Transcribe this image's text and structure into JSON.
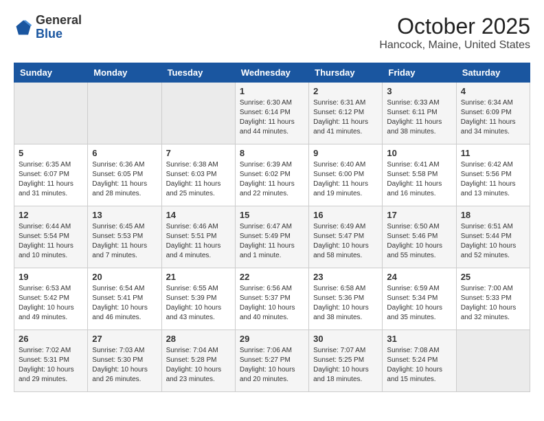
{
  "logo": {
    "general": "General",
    "blue": "Blue"
  },
  "header": {
    "title": "October 2025",
    "location": "Hancock, Maine, United States"
  },
  "days_of_week": [
    "Sunday",
    "Monday",
    "Tuesday",
    "Wednesday",
    "Thursday",
    "Friday",
    "Saturday"
  ],
  "weeks": [
    [
      {
        "day": "",
        "info": ""
      },
      {
        "day": "",
        "info": ""
      },
      {
        "day": "",
        "info": ""
      },
      {
        "day": "1",
        "info": "Sunrise: 6:30 AM\nSunset: 6:14 PM\nDaylight: 11 hours\nand 44 minutes."
      },
      {
        "day": "2",
        "info": "Sunrise: 6:31 AM\nSunset: 6:12 PM\nDaylight: 11 hours\nand 41 minutes."
      },
      {
        "day": "3",
        "info": "Sunrise: 6:33 AM\nSunset: 6:11 PM\nDaylight: 11 hours\nand 38 minutes."
      },
      {
        "day": "4",
        "info": "Sunrise: 6:34 AM\nSunset: 6:09 PM\nDaylight: 11 hours\nand 34 minutes."
      }
    ],
    [
      {
        "day": "5",
        "info": "Sunrise: 6:35 AM\nSunset: 6:07 PM\nDaylight: 11 hours\nand 31 minutes."
      },
      {
        "day": "6",
        "info": "Sunrise: 6:36 AM\nSunset: 6:05 PM\nDaylight: 11 hours\nand 28 minutes."
      },
      {
        "day": "7",
        "info": "Sunrise: 6:38 AM\nSunset: 6:03 PM\nDaylight: 11 hours\nand 25 minutes."
      },
      {
        "day": "8",
        "info": "Sunrise: 6:39 AM\nSunset: 6:02 PM\nDaylight: 11 hours\nand 22 minutes."
      },
      {
        "day": "9",
        "info": "Sunrise: 6:40 AM\nSunset: 6:00 PM\nDaylight: 11 hours\nand 19 minutes."
      },
      {
        "day": "10",
        "info": "Sunrise: 6:41 AM\nSunset: 5:58 PM\nDaylight: 11 hours\nand 16 minutes."
      },
      {
        "day": "11",
        "info": "Sunrise: 6:42 AM\nSunset: 5:56 PM\nDaylight: 11 hours\nand 13 minutes."
      }
    ],
    [
      {
        "day": "12",
        "info": "Sunrise: 6:44 AM\nSunset: 5:54 PM\nDaylight: 11 hours\nand 10 minutes."
      },
      {
        "day": "13",
        "info": "Sunrise: 6:45 AM\nSunset: 5:53 PM\nDaylight: 11 hours\nand 7 minutes."
      },
      {
        "day": "14",
        "info": "Sunrise: 6:46 AM\nSunset: 5:51 PM\nDaylight: 11 hours\nand 4 minutes."
      },
      {
        "day": "15",
        "info": "Sunrise: 6:47 AM\nSunset: 5:49 PM\nDaylight: 11 hours\nand 1 minute."
      },
      {
        "day": "16",
        "info": "Sunrise: 6:49 AM\nSunset: 5:47 PM\nDaylight: 10 hours\nand 58 minutes."
      },
      {
        "day": "17",
        "info": "Sunrise: 6:50 AM\nSunset: 5:46 PM\nDaylight: 10 hours\nand 55 minutes."
      },
      {
        "day": "18",
        "info": "Sunrise: 6:51 AM\nSunset: 5:44 PM\nDaylight: 10 hours\nand 52 minutes."
      }
    ],
    [
      {
        "day": "19",
        "info": "Sunrise: 6:53 AM\nSunset: 5:42 PM\nDaylight: 10 hours\nand 49 minutes."
      },
      {
        "day": "20",
        "info": "Sunrise: 6:54 AM\nSunset: 5:41 PM\nDaylight: 10 hours\nand 46 minutes."
      },
      {
        "day": "21",
        "info": "Sunrise: 6:55 AM\nSunset: 5:39 PM\nDaylight: 10 hours\nand 43 minutes."
      },
      {
        "day": "22",
        "info": "Sunrise: 6:56 AM\nSunset: 5:37 PM\nDaylight: 10 hours\nand 40 minutes."
      },
      {
        "day": "23",
        "info": "Sunrise: 6:58 AM\nSunset: 5:36 PM\nDaylight: 10 hours\nand 38 minutes."
      },
      {
        "day": "24",
        "info": "Sunrise: 6:59 AM\nSunset: 5:34 PM\nDaylight: 10 hours\nand 35 minutes."
      },
      {
        "day": "25",
        "info": "Sunrise: 7:00 AM\nSunset: 5:33 PM\nDaylight: 10 hours\nand 32 minutes."
      }
    ],
    [
      {
        "day": "26",
        "info": "Sunrise: 7:02 AM\nSunset: 5:31 PM\nDaylight: 10 hours\nand 29 minutes."
      },
      {
        "day": "27",
        "info": "Sunrise: 7:03 AM\nSunset: 5:30 PM\nDaylight: 10 hours\nand 26 minutes."
      },
      {
        "day": "28",
        "info": "Sunrise: 7:04 AM\nSunset: 5:28 PM\nDaylight: 10 hours\nand 23 minutes."
      },
      {
        "day": "29",
        "info": "Sunrise: 7:06 AM\nSunset: 5:27 PM\nDaylight: 10 hours\nand 20 minutes."
      },
      {
        "day": "30",
        "info": "Sunrise: 7:07 AM\nSunset: 5:25 PM\nDaylight: 10 hours\nand 18 minutes."
      },
      {
        "day": "31",
        "info": "Sunrise: 7:08 AM\nSunset: 5:24 PM\nDaylight: 10 hours\nand 15 minutes."
      },
      {
        "day": "",
        "info": ""
      }
    ]
  ]
}
